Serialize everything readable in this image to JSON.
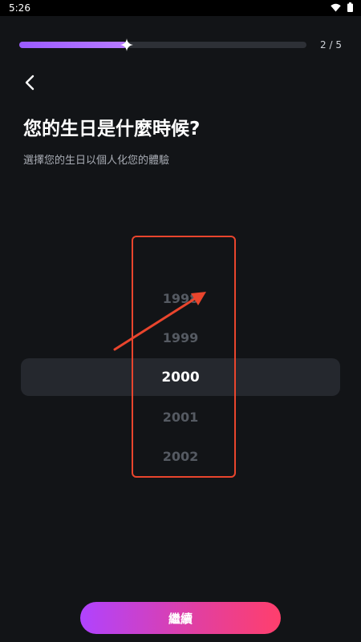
{
  "status_bar": {
    "time": "5:26",
    "icons": [
      "wifi-icon",
      "battery-icon"
    ]
  },
  "progress": {
    "label": "2 / 5",
    "fraction": 0.375,
    "fill_color": "#9b5bff",
    "marker_icon": "sparkle-icon"
  },
  "header": {
    "back_icon": "chevron-left-icon",
    "title": "您的生日是什麼時候?",
    "subtitle": "選擇您的生日以個人化您的體驗"
  },
  "year_picker": {
    "items": [
      "1998",
      "1999",
      "2000",
      "2001",
      "2002"
    ],
    "selected": "2000"
  },
  "annotation": {
    "color": "#e9452d"
  },
  "footer": {
    "continue_label": "繼續",
    "gradient": [
      "#b043ff",
      "#ff3f6c"
    ]
  }
}
